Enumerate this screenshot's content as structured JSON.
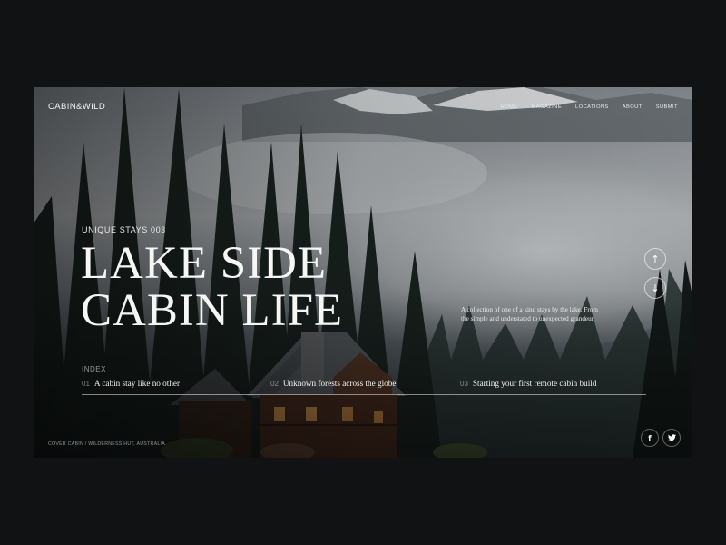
{
  "brand": "CABIN&WILD",
  "nav": [
    "HOME",
    "MAGAZINE",
    "LOCATIONS",
    "ABOUT",
    "SUBMIT"
  ],
  "hero": {
    "eyebrow": "UNIQUE STAYS 003",
    "title_line1": "LAKE SIDE",
    "title_line2": "CABIN LIFE",
    "description": "A collection of one of a kind stays by the lake. From the simple and understated to unexpected grandeur."
  },
  "scroll": {
    "up_icon": "arrow-up-icon",
    "down_icon": "arrow-down-icon"
  },
  "index": {
    "label": "INDEX",
    "items": [
      {
        "num": "01",
        "text": "A cabin stay like no other"
      },
      {
        "num": "02",
        "text": "Unknown forests across the globe"
      },
      {
        "num": "03",
        "text": "Starting your first remote cabin build"
      }
    ]
  },
  "caption": "COVER CABIN / WILDERNESS HUT, AUSTRALIA",
  "social": {
    "facebook": "f",
    "twitter": "twitter-bird-icon"
  },
  "colors": {
    "page": "#111213",
    "text": "#f6f6f4"
  }
}
